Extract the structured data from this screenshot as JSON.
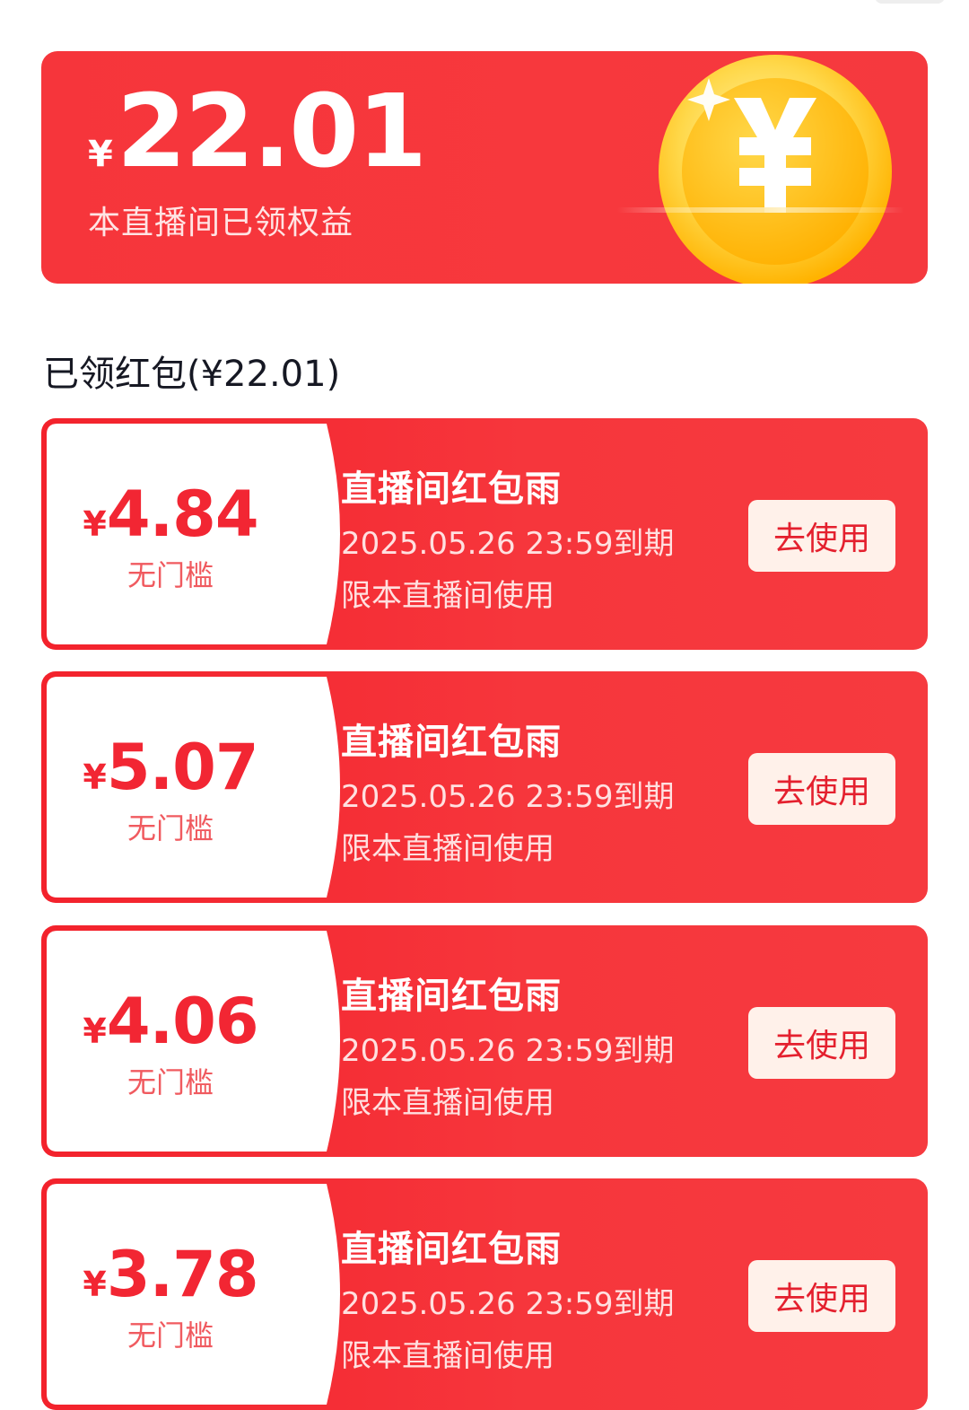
{
  "summary": {
    "currency": "¥",
    "total": "22.01",
    "subtitle": "本直播间已领权益"
  },
  "section": {
    "title": "已领红包(¥22.01)"
  },
  "coupons": [
    {
      "currency": "¥",
      "amount": "4.84",
      "threshold": "无门槛",
      "title": "直播间红包雨",
      "expiry": "2025.05.26 23:59到期",
      "scope": "限本直播间使用",
      "button": "去使用"
    },
    {
      "currency": "¥",
      "amount": "5.07",
      "threshold": "无门槛",
      "title": "直播间红包雨",
      "expiry": "2025.05.26 23:59到期",
      "scope": "限本直播间使用",
      "button": "去使用"
    },
    {
      "currency": "¥",
      "amount": "4.06",
      "threshold": "无门槛",
      "title": "直播间红包雨",
      "expiry": "2025.05.26 23:59到期",
      "scope": "限本直播间使用",
      "button": "去使用"
    },
    {
      "currency": "¥",
      "amount": "3.78",
      "threshold": "无门槛",
      "title": "直播间红包雨",
      "expiry": "2025.05.26 23:59到期",
      "scope": "限本直播间使用",
      "button": "去使用"
    }
  ],
  "colors": {
    "brand_red": "#f6353b",
    "coin_gold": "#ffc21a",
    "button_bg": "#fff1ea",
    "button_text": "#e4202e"
  },
  "icons": {
    "coin": "yuan-coin-icon"
  }
}
